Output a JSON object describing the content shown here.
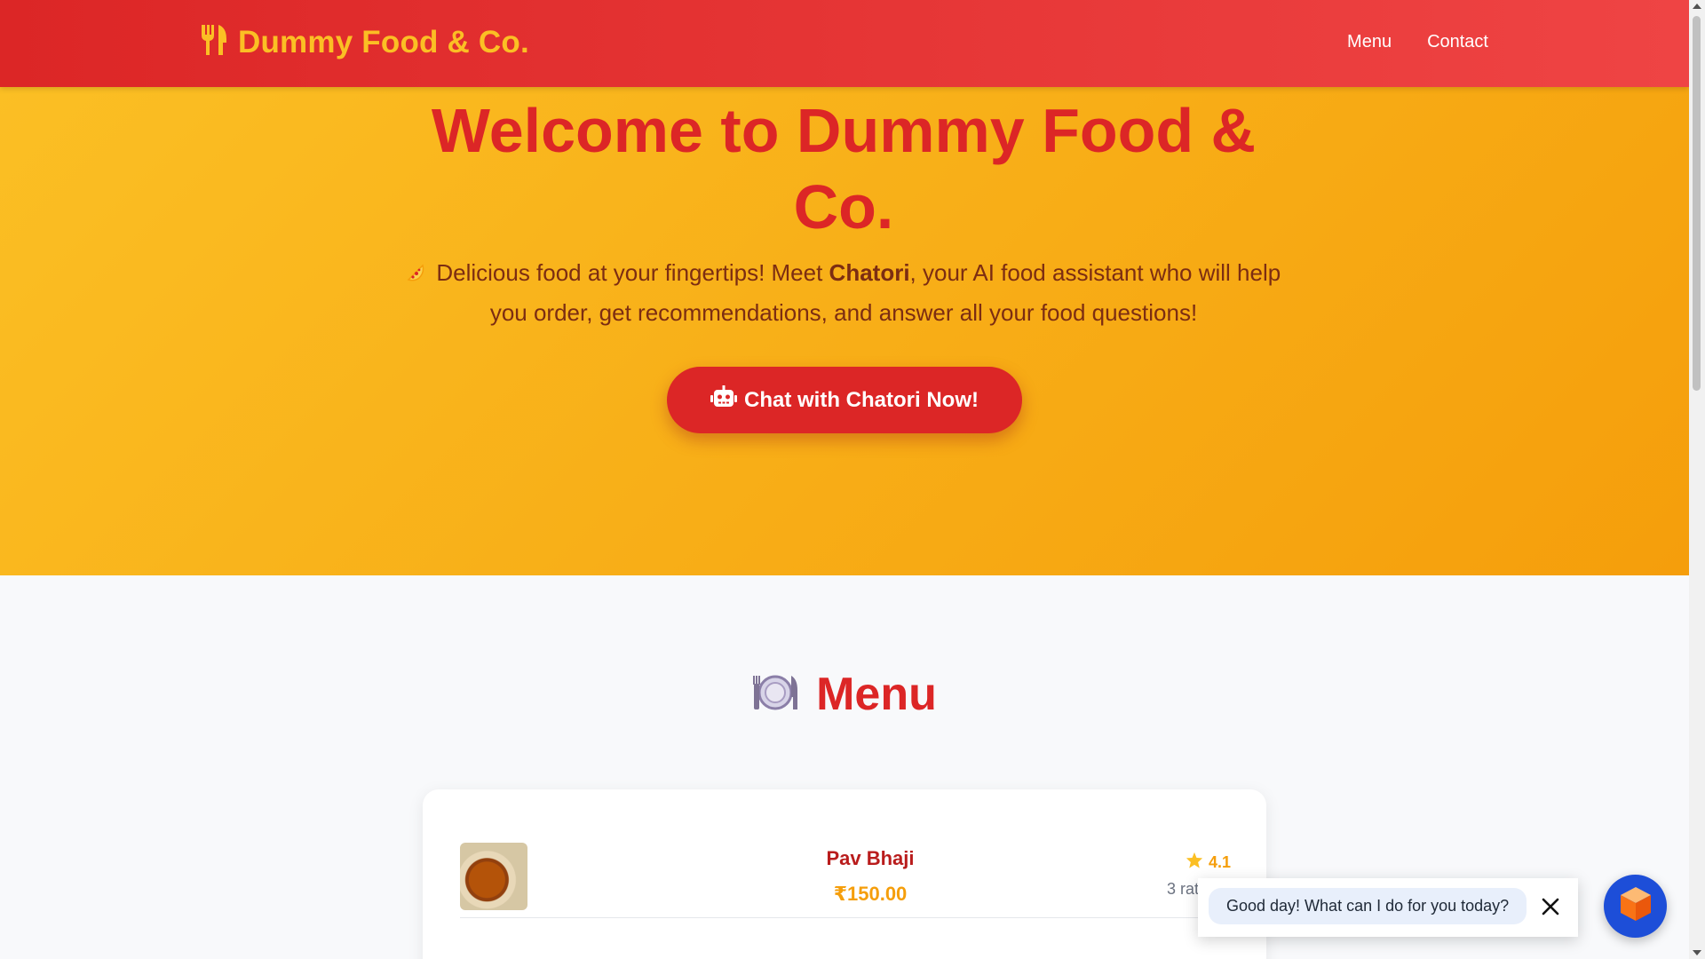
{
  "header": {
    "brand": "Dummy Food & Co.",
    "nav": [
      {
        "label": "Menu"
      },
      {
        "label": "Contact"
      }
    ]
  },
  "hero": {
    "title": "Welcome to Dummy Food & Co.",
    "subtitle_lead": "Delicious food at your fingertips! Meet ",
    "assistant_name": "Chatori",
    "subtitle_rest": ", your AI food assistant who will help you order, get recommendations, and answer all your food questions!",
    "cta_label": "Chat with Chatori Now!"
  },
  "menu": {
    "title": "Menu",
    "items": [
      {
        "name": "Pav Bhaji",
        "price": "₹150.00",
        "rating": "4.1",
        "ratings_count": "3 ratings"
      }
    ]
  },
  "chat": {
    "message": "Good day! What can I do for you today?"
  },
  "colors": {
    "brand_red": "#dc2626",
    "brand_yellow": "#fbbf24",
    "accent_orange": "#f59e0b",
    "launcher_blue": "#1d4ed8"
  }
}
